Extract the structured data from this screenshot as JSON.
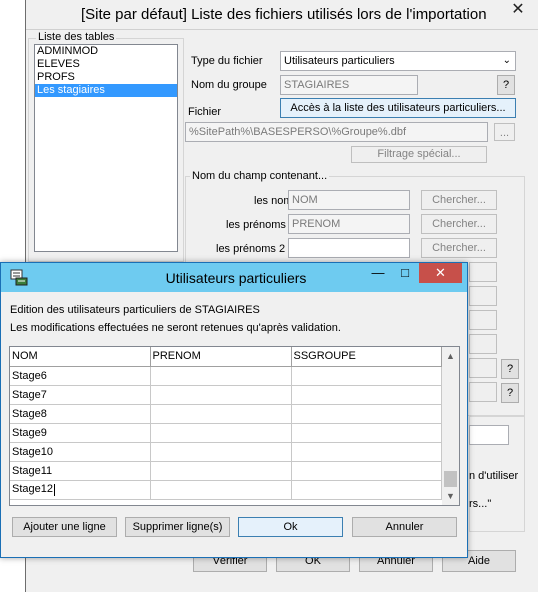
{
  "main_window": {
    "title": "[Site par défaut] Liste des fichiers utilisés lors de l'importation",
    "close_glyph": "✕",
    "tables_group_label": "Liste des tables",
    "tables": [
      "ADMINMOD",
      "ELEVES",
      "PROFS",
      "Les stagiaires"
    ],
    "selected_table": "Les stagiaires",
    "file_type_label": "Type du fichier",
    "file_type_value": "Utilisateurs particuliers",
    "group_name_label": "Nom du groupe",
    "group_name_value": "STAGIAIRES",
    "help_glyph": "?",
    "file_label": "Fichier",
    "access_list_button": "Accès à la liste des utilisateurs particuliers...",
    "file_path_value": "%SitePath%\\BASESPERSO\\%Groupe%.dbf",
    "browse_button": "...",
    "special_filter_button": "Filtrage spécial...",
    "field_group_label": "Nom du champ contenant...",
    "fields": [
      {
        "label": "les noms",
        "value": "NOM",
        "search": "Chercher..."
      },
      {
        "label": "les prénoms",
        "value": "PRENOM",
        "search": "Chercher..."
      },
      {
        "label": "les prénoms 2",
        "value": "",
        "search": "Chercher..."
      }
    ],
    "partial_text_1": "n d'utiliser",
    "partial_text_2": "rs...\"",
    "bottom_buttons": {
      "verify": "Vérifier",
      "ok": "OK",
      "cancel": "Annuler",
      "help": "Aide"
    }
  },
  "dialog": {
    "title": "Utilisateurs particuliers",
    "minimize_glyph": "—",
    "maximize_glyph": "□",
    "close_glyph": "✕",
    "intro_line_1": "Edition des utilisateurs particuliers de STAGIAIRES",
    "intro_line_2": "Les modifications effectuées ne seront retenues qu'après validation.",
    "columns": [
      "NOM",
      "PRENOM",
      "SSGROUPE"
    ],
    "rows": [
      [
        "Stage6",
        "",
        ""
      ],
      [
        "Stage7",
        "",
        ""
      ],
      [
        "Stage8",
        "",
        ""
      ],
      [
        "Stage9",
        "",
        ""
      ],
      [
        "Stage10",
        "",
        ""
      ],
      [
        "Stage11",
        "",
        ""
      ],
      [
        "Stage12",
        "",
        ""
      ]
    ],
    "buttons": {
      "add_row": "Ajouter une ligne",
      "delete_row": "Supprimer ligne(s)",
      "ok": "Ok",
      "cancel": "Annuler"
    }
  }
}
